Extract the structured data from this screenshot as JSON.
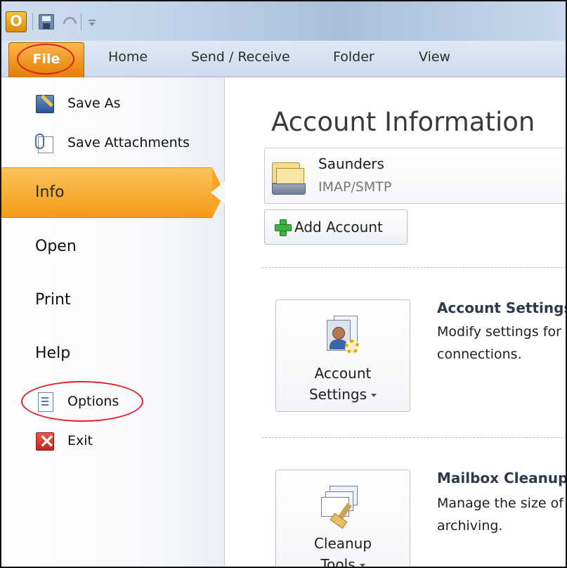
{
  "quick_access": {
    "logo": "outlook-logo",
    "icons": [
      "save-icon",
      "undo-icon",
      "customize-toolbar-icon"
    ]
  },
  "ribbon": {
    "file_tab": "File",
    "tabs": [
      "Home",
      "Send / Receive",
      "Folder",
      "View"
    ]
  },
  "backstage": {
    "commands": {
      "save_as": "Save As",
      "save_attachments": "Save Attachments",
      "options": "Options",
      "exit": "Exit"
    },
    "nav": {
      "info": "Info",
      "open": "Open",
      "print": "Print",
      "help": "Help"
    }
  },
  "main": {
    "title": "Account Information",
    "account": {
      "name": "Saunders",
      "type": "IMAP/SMTP"
    },
    "add_account": "Add Account",
    "account_settings": {
      "button_line1": "Account",
      "button_line2": "Settings",
      "heading": "Account Settings",
      "desc_line1": "Modify settings for this account or set up more connections.",
      "desc_line2": "connections."
    },
    "mailbox_cleanup": {
      "button_line1": "Cleanup",
      "button_line2": "Tools",
      "heading": "Mailbox Cleanup",
      "desc_line1": "Manage the size of your mailbox by emptying Deleted Items and archiving.",
      "desc_line2": "archiving."
    }
  },
  "colors": {
    "accent_orange": "#f49a14",
    "annotation_red": "#e0202b",
    "ribbon_blue": "#cedcee"
  }
}
